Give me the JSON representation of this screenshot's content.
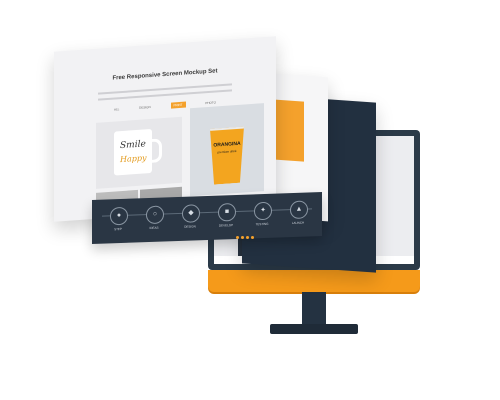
{
  "mockup": {
    "front_title": "Free Responsive Screen Mockup Set",
    "filters": [
      "ALL",
      "DESIGN",
      "PRINT",
      "PHOTO"
    ],
    "active_filter": "PRINT",
    "mug_text_line1": "Smile",
    "mug_text_line2": "Happy",
    "cup_text_line1": "ORANGINA",
    "cup_text_line2": "premium drink"
  },
  "ribbon": {
    "steps": [
      {
        "label": "STEP"
      },
      {
        "label": "IDEAS"
      },
      {
        "label": "DESIGN"
      },
      {
        "label": "DEVELOP"
      },
      {
        "label": "TESTING"
      },
      {
        "label": "LAUNCH"
      }
    ]
  },
  "colors": {
    "accent": "#f4a12c",
    "navy": "#2a3644",
    "monitor_chin": "#f59a1a"
  }
}
